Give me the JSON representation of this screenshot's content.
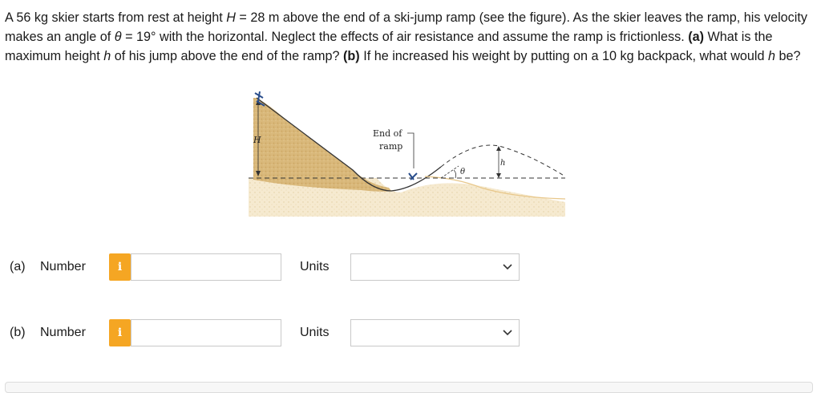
{
  "question": {
    "p1": "A 56 kg skier starts from rest at height ",
    "var_H": "H",
    "p2": " = 28 m above the end of a ski-jump ramp (see the figure). As the skier leaves the ramp, his velocity makes an angle of ",
    "var_theta": "θ",
    "p3": " = 19° with the horizontal. Neglect the effects of air resistance and assume the ramp is frictionless. ",
    "a_label": "(a)",
    "p4": " What is the maximum height ",
    "var_h": "h",
    "p5": " of his jump above the end of the ramp? ",
    "b_label": "(b)",
    "p6": " If he increased his weight by putting on a 10 kg backpack, what would ",
    "var_h2": "h",
    "p7": " be?"
  },
  "figure": {
    "label_H": "H",
    "end_of_ramp_line1": "End of",
    "end_of_ramp_line2": "ramp",
    "label_theta": "θ",
    "label_h": "h"
  },
  "answers": [
    {
      "part": "(a)",
      "number_label": "Number",
      "info_icon": "i",
      "value": "",
      "units_label": "Units",
      "units_value": ""
    },
    {
      "part": "(b)",
      "number_label": "Number",
      "info_icon": "i",
      "value": "",
      "units_label": "Units",
      "units_value": ""
    }
  ],
  "colors": {
    "info_button": "#f5a623",
    "hill_fill": "#d9b87a",
    "ground_fill": "#f3e4c2",
    "dashed_line": "#333333"
  }
}
